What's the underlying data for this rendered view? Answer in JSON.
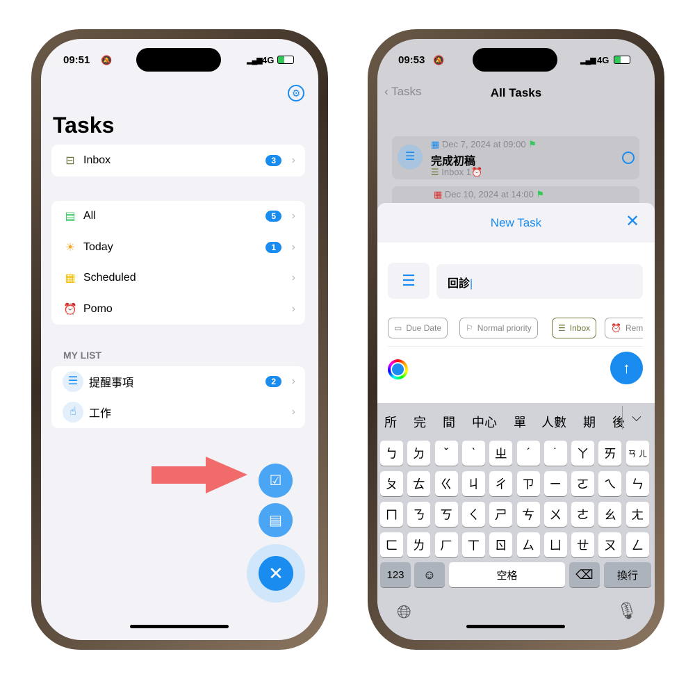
{
  "left_phone": {
    "status": {
      "time": "09:51",
      "network": "4G"
    },
    "title": "Tasks",
    "inbox": {
      "label": "Inbox",
      "count": "3"
    },
    "smart_lists": [
      {
        "label": "All",
        "count": "5",
        "icon": "all-icon"
      },
      {
        "label": "Today",
        "count": "1",
        "icon": "sun-icon"
      },
      {
        "label": "Scheduled",
        "count": "",
        "icon": "calendar-icon"
      },
      {
        "label": "Pomo",
        "count": "",
        "icon": "alarm-clock-icon"
      }
    ],
    "my_list_header": "MY LIST",
    "my_lists": [
      {
        "label": "提醒事項",
        "count": "2"
      },
      {
        "label": "工作",
        "count": ""
      }
    ]
  },
  "right_phone": {
    "status": {
      "time": "09:53",
      "network": "4G"
    },
    "nav": {
      "back": "Tasks",
      "title": "All Tasks"
    },
    "tasks": [
      {
        "date": "Dec 7, 2024 at 09:00",
        "title": "完成初稿",
        "list": "Inbox",
        "reminders": "1"
      },
      {
        "date": "Dec 10, 2024 at 14:00"
      }
    ],
    "sheet": {
      "title": "New Task",
      "input_value": "回診",
      "chips": [
        "Due Date",
        "Normal priority",
        "Inbox",
        "Rem"
      ]
    },
    "candidates": [
      "所",
      "完",
      "間",
      "中心",
      "單",
      "人數",
      "期",
      "後"
    ],
    "keyboard": {
      "rows": [
        [
          "ㄅ",
          "ㄉ",
          "ˇ",
          "ˋ",
          "ㄓ",
          "ˊ",
          "˙",
          "ㄚ",
          "ㄞ",
          "ㄢ ㄦ"
        ],
        [
          "ㄆ",
          "ㄊ",
          "ㄍ",
          "ㄐ",
          "ㄔ",
          "ㄗ",
          "ㄧ",
          "ㄛ",
          "ㄟ",
          "ㄣ"
        ],
        [
          "ㄇ",
          "ㄋ",
          "ㄎ",
          "ㄑ",
          "ㄕ",
          "ㄘ",
          "ㄨ",
          "ㄜ",
          "ㄠ",
          "ㄤ"
        ],
        [
          "ㄈ",
          "ㄌ",
          "ㄏ",
          "ㄒ",
          "ㄖ",
          "ㄙ",
          "ㄩ",
          "ㄝ",
          "ㄡ",
          "ㄥ"
        ]
      ],
      "numbers": "123",
      "space": "空格",
      "return": "換行"
    }
  },
  "colors": {
    "accent": "#1a8cf0",
    "arrow": "#f26b6b",
    "inbox_chip": "#6b7a3a"
  }
}
